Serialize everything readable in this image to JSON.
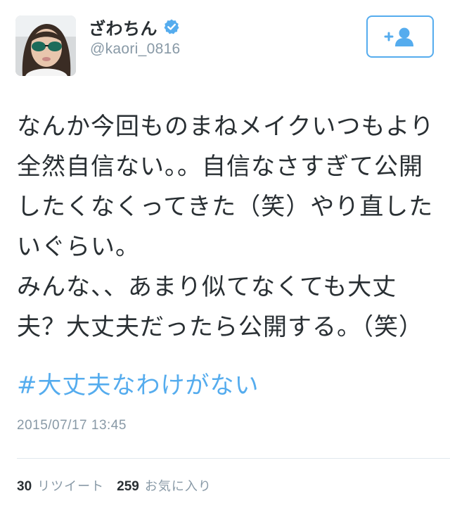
{
  "user": {
    "display_name": "ざわちん",
    "handle": "@kaori_0816",
    "verified": true
  },
  "follow_button": {
    "icon": "follow-user-icon"
  },
  "tweet": {
    "paragraphs": [
      "なんか今回ものまねメイクいつもより全然自信ない。。自信なさすぎて公開したくなくってきた（笑）やり直したいぐらい。",
      "みんな、、あまり似てなくても大丈夫？大丈夫だったら公開する。（笑）"
    ],
    "hashtag": "#大丈夫なわけがない",
    "timestamp": "2015/07/17 13:45"
  },
  "stats": {
    "retweets_count": "30",
    "retweets_label": "リツイート",
    "likes_count": "259",
    "likes_label": "お気に入り"
  },
  "colors": {
    "accent": "#55acee",
    "text": "#292f33",
    "muted": "#8899a6",
    "divider": "#e1e8ed"
  }
}
